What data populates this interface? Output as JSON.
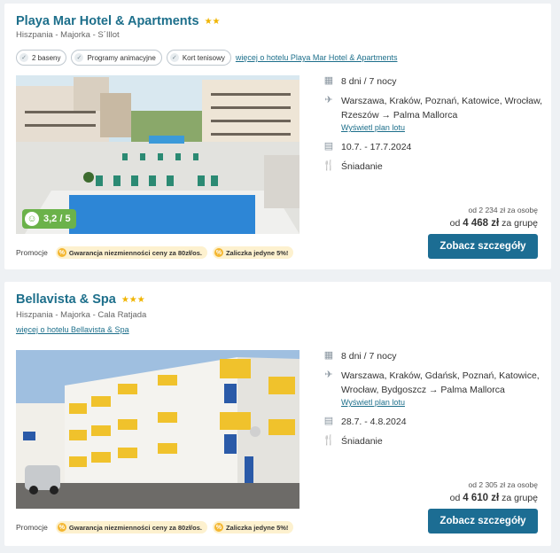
{
  "hotels": [
    {
      "name": "Playa Mar Hotel & Apartments",
      "stars": "★★",
      "location": "Hiszpania - Majorka - S´Illot",
      "tags": [
        "2 baseny",
        "Programy animacyjne",
        "Kort tenisowy"
      ],
      "more_link": "więcej o hotelu Playa Mar Hotel & Apartments",
      "rating": "3,2 / 5",
      "duration": "8 dni / 7 nocy",
      "flight": "Warszawa, Kraków, Poznań, Katowice, Wrocław, Rzeszów → Palma Mallorca",
      "flight_plan": "Wyświetl plan lotu",
      "dates": "10.7. - 17.7.2024",
      "board": "Śniadanie",
      "price_per_person": "od 2 234 zł za osobę",
      "price_prefix": "od",
      "price_group": "4 468 zł",
      "price_group_suffix": "za grupę",
      "cta": "Zobacz szczegóły",
      "promo_label": "Promocje",
      "promos": [
        "Gwarancja niezmienności ceny za 80zł/os.",
        "Zaliczka jedyne 5%!"
      ]
    },
    {
      "name": "Bellavista & Spa",
      "stars": "★★★",
      "location": "Hiszpania - Majorka - Cala Ratjada",
      "more_link": "więcej o hotelu Bellavista & Spa",
      "duration": "8 dni / 7 nocy",
      "flight": "Warszawa, Kraków, Gdańsk, Poznań, Katowice, Wrocław, Bydgoszcz → Palma Mallorca",
      "flight_plan": "Wyświetl plan lotu",
      "dates": "28.7. - 4.8.2024",
      "board": "Śniadanie",
      "price_per_person": "od 2 305 zł za osobę",
      "price_prefix": "od",
      "price_group": "4 610 zł",
      "price_group_suffix": "za grupę",
      "cta": "Zobacz szczegóły",
      "promo_label": "Promocje",
      "promos": [
        "Gwarancja niezmienności ceny za 80zł/os.",
        "Zaliczka jedyne 5%!"
      ]
    }
  ],
  "colors": {
    "accent": "#1c6d93",
    "link": "#1d6f8b",
    "rating": "#6bb24a",
    "star": "#f0b400"
  }
}
